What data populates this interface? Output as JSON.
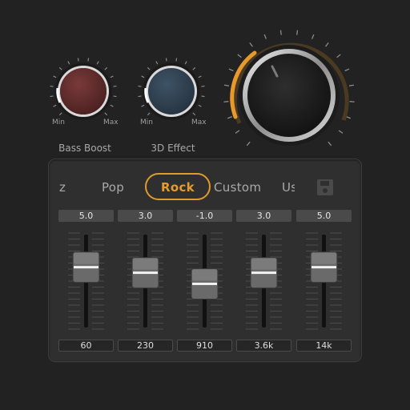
{
  "knobs": {
    "bass_boost": {
      "title": "Bass Boost",
      "min_label": "Min",
      "max_label": "Max",
      "level": 0.0,
      "color": "#6b2f2f"
    },
    "effect_3d": {
      "title": "3D Effect",
      "min_label": "Min",
      "max_label": "Max",
      "level": 0.0,
      "color": "#2f4050"
    },
    "volume": {
      "level": 0.35,
      "accent": "#e8992b"
    }
  },
  "presets": {
    "items": [
      "z",
      "Pop",
      "Rock",
      "Custom",
      "Us"
    ],
    "selected": "Rock",
    "save_icon": "save-icon"
  },
  "eq": {
    "bands": [
      {
        "value": "5.0",
        "freq": "60",
        "gain": 5.0
      },
      {
        "value": "3.0",
        "freq": "230",
        "gain": 3.0
      },
      {
        "value": "-1.0",
        "freq": "910",
        "gain": -1.0
      },
      {
        "value": "3.0",
        "freq": "3.6k",
        "gain": 3.0
      },
      {
        "value": "5.0",
        "freq": "14k",
        "gain": 5.0
      }
    ],
    "range": [
      -15,
      15
    ]
  },
  "colors": {
    "accent": "#e39c2d",
    "background": "#222222",
    "panel": "#2f2f2f"
  }
}
